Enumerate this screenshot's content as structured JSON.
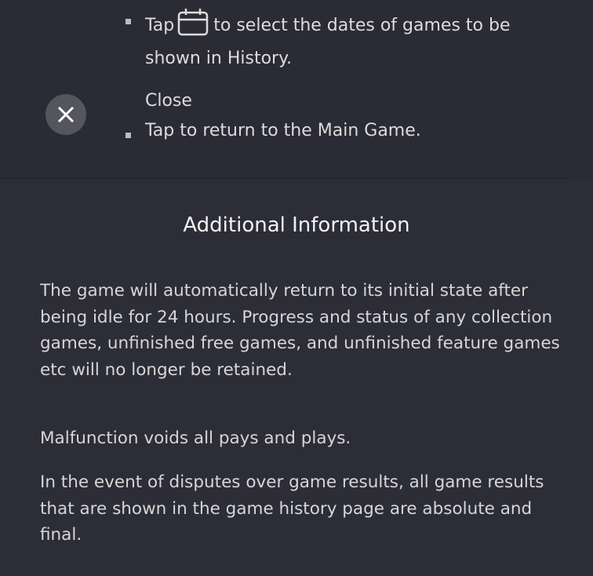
{
  "history_section": {
    "calendar_item": {
      "prefix": "Tap",
      "icon": "calendar-icon",
      "suffix": "to select the dates of games to be",
      "line2": "shown in History."
    }
  },
  "close_section": {
    "icon": "close-icon",
    "title": "Close",
    "description": "Tap to return to the Main Game."
  },
  "additional_info": {
    "heading": "Additional Information",
    "paragraphs": [
      "The game will automatically return to its initial state after being idle for 24 hours. Progress and status of any collection games, unfinished free games, and unfinished feature games etc will no longer be retained.",
      "Malfunction voids all pays and plays.",
      "In the event of disputes over game results, all game results that are shown in the game history page are absolute and final."
    ]
  },
  "colors": {
    "background": "#2b2b36",
    "text": "#dcdcdc",
    "close_button": "#55555e"
  }
}
